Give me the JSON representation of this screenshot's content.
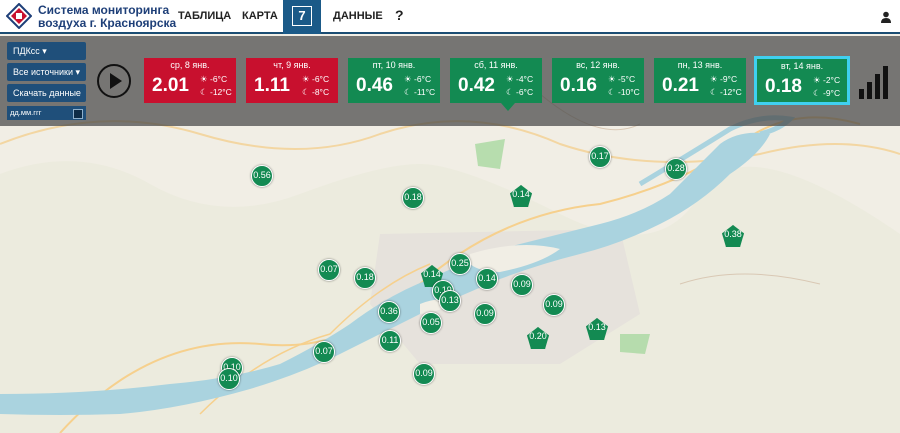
{
  "header": {
    "brand_line1": "Система мониторинга",
    "brand_line2": "воздуха г. Красноярска",
    "nav": [
      "ТАБЛИЦА",
      "КАРТА",
      "ДАННЫЕ"
    ],
    "badge": "7",
    "help": "?"
  },
  "controls": {
    "pollutant": "ПДКсс ▾",
    "sources": "Все источники ▾",
    "download": "Скачать данные",
    "date_placeholder": "дд.мм.ггг"
  },
  "forecast": [
    {
      "date": "ср, 8 янв.",
      "value": "2.01",
      "t_day": "-6°C",
      "t_night": "-12°C",
      "status": "red"
    },
    {
      "date": "чт, 9 янв.",
      "value": "1.11",
      "t_day": "-6°C",
      "t_night": "-8°C",
      "status": "red"
    },
    {
      "date": "пт, 10 янв.",
      "value": "0.46",
      "t_day": "-6°C",
      "t_night": "-11°C",
      "status": "green"
    },
    {
      "date": "сб, 11 янв.",
      "value": "0.42",
      "t_day": "-4°C",
      "t_night": "-6°C",
      "status": "green"
    },
    {
      "date": "вс, 12 янв.",
      "value": "0.16",
      "t_day": "-5°C",
      "t_night": "-10°C",
      "status": "green"
    },
    {
      "date": "пн, 13 янв.",
      "value": "0.21",
      "t_day": "-9°C",
      "t_night": "-12°C",
      "status": "green"
    },
    {
      "date": "вт, 14 янв.",
      "value": "0.18",
      "t_day": "-2°C",
      "t_night": "-9°C",
      "status": "green"
    }
  ],
  "colors": {
    "red": "#c8102e",
    "green": "#138a52",
    "nav_blue": "#1b5a88",
    "selected": "#3fd0f0"
  },
  "markers": [
    "0.56",
    "0.18",
    "0.14",
    "0.17",
    "0.28",
    "0.38",
    "0.07",
    "0.18",
    "0.14",
    "0.25",
    "0.19",
    "0.14",
    "0.09",
    "0.13",
    "0.36",
    "0.09",
    "0.09",
    "0.05",
    "0.11",
    "0.07",
    "0.20",
    "0.13",
    "0.09",
    "0.10",
    "0.10"
  ]
}
